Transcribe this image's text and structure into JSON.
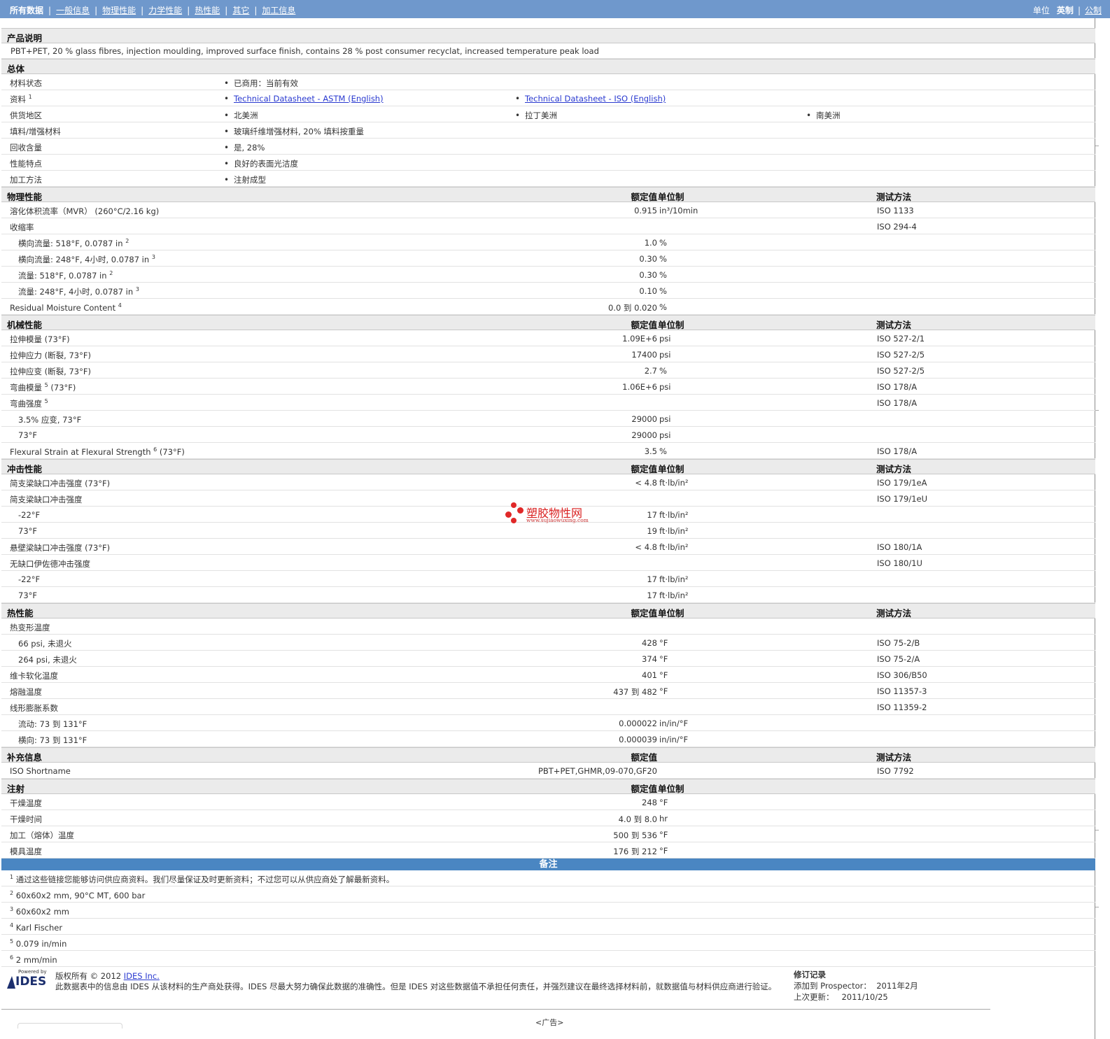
{
  "nav": {
    "items": [
      "所有数据",
      "一般信息",
      "物理性能",
      "力学性能",
      "热性能",
      "其它",
      "加工信息"
    ],
    "units_label": "单位",
    "unit_english": "英制",
    "unit_metric": "公制"
  },
  "product": {
    "heading": "产品说明",
    "description": "PBT+PET, 20 % glass fibres, injection moulding, improved surface finish, contains 28 % post consumer recyclat, increased temperature peak load"
  },
  "general": {
    "heading": "总体",
    "rows": [
      {
        "label": "材料状态",
        "sup": "",
        "values": [
          "已商用：当前有效"
        ]
      },
      {
        "label": "资料",
        "sup": "1",
        "values": [
          "Technical Datasheet - ASTM (English)",
          "Technical Datasheet - ISO (English)"
        ],
        "links": true
      },
      {
        "label": "供货地区",
        "sup": "",
        "values": [
          "北美洲",
          "拉丁美洲",
          "南美洲"
        ]
      },
      {
        "label": "填料/增强材料",
        "sup": "",
        "values": [
          "玻璃纤维增强材料, 20% 填料按重量"
        ]
      },
      {
        "label": "回收含量",
        "sup": "",
        "values": [
          "是, 28%"
        ]
      },
      {
        "label": "性能特点",
        "sup": "",
        "values": [
          "良好的表面光洁度"
        ]
      },
      {
        "label": "加工方法",
        "sup": "",
        "values": [
          "注射成型"
        ]
      }
    ]
  },
  "headers": {
    "nominal": "额定值",
    "unit": "单位制",
    "method": "测试方法"
  },
  "sections": [
    {
      "title": "物理性能",
      "show_unit": true,
      "show_method": true,
      "rows": [
        {
          "label": "溶化体积流率（MVR） (260°C/2.16 kg)",
          "sup": "",
          "value": "0.915",
          "unit": "in³/10min",
          "method": "ISO 1133",
          "sub": false
        },
        {
          "label": "收缩率",
          "sup": "",
          "value": "",
          "unit": "",
          "method": "ISO 294-4",
          "sub": false
        },
        {
          "label": "横向流量: 518°F, 0.0787 in",
          "sup": "2",
          "value": "1.0",
          "unit": "%",
          "method": "",
          "sub": true
        },
        {
          "label": "横向流量: 248°F, 4小时, 0.0787 in",
          "sup": "3",
          "value": "0.30",
          "unit": "%",
          "method": "",
          "sub": true
        },
        {
          "label": "流量: 518°F, 0.0787 in",
          "sup": "2",
          "value": "0.30",
          "unit": "%",
          "method": "",
          "sub": true
        },
        {
          "label": "流量: 248°F, 4小时, 0.0787 in",
          "sup": "3",
          "value": "0.10",
          "unit": "%",
          "method": "",
          "sub": true
        },
        {
          "label": "Residual Moisture Content",
          "sup": "4",
          "value": "0.0 到 0.020",
          "unit": "%",
          "method": "",
          "sub": false
        }
      ]
    },
    {
      "title": "机械性能",
      "show_unit": true,
      "show_method": true,
      "rows": [
        {
          "label": "拉伸模量 (73°F)",
          "sup": "",
          "value": "1.09E+6",
          "unit": "psi",
          "method": "ISO 527-2/1",
          "sub": false
        },
        {
          "label": "拉伸应力 (断裂, 73°F)",
          "sup": "",
          "value": "17400",
          "unit": "psi",
          "method": "ISO 527-2/5",
          "sub": false
        },
        {
          "label": "拉伸应变 (断裂, 73°F)",
          "sup": "",
          "value": "2.7",
          "unit": "%",
          "method": "ISO 527-2/5",
          "sub": false
        },
        {
          "label": "弯曲模量",
          "sup": "5",
          "suffix": " (73°F)",
          "value": "1.06E+6",
          "unit": "psi",
          "method": "ISO 178/A",
          "sub": false
        },
        {
          "label": "弯曲强度",
          "sup": "5",
          "value": "",
          "unit": "",
          "method": "ISO 178/A",
          "sub": false
        },
        {
          "label": "3.5% 应变, 73°F",
          "sup": "",
          "value": "29000",
          "unit": "psi",
          "method": "",
          "sub": true
        },
        {
          "label": "73°F",
          "sup": "",
          "value": "29000",
          "unit": "psi",
          "method": "",
          "sub": true
        },
        {
          "label": "Flexural Strain at Flexural Strength",
          "sup": "6",
          "suffix": " (73°F)",
          "value": "3.5",
          "unit": "%",
          "method": "ISO 178/A",
          "sub": false
        }
      ]
    },
    {
      "title": "冲击性能",
      "show_unit": true,
      "show_method": true,
      "rows": [
        {
          "label": "简支梁缺口冲击强度 (73°F)",
          "sup": "",
          "value": "< 4.8",
          "unit": "ft·lb/in²",
          "method": "ISO 179/1eA",
          "sub": false
        },
        {
          "label": "简支梁缺口冲击强度",
          "sup": "",
          "value": "",
          "unit": "",
          "method": "ISO 179/1eU",
          "sub": false
        },
        {
          "label": "-22°F",
          "sup": "",
          "value": "17",
          "unit": "ft·lb/in²",
          "method": "",
          "sub": true
        },
        {
          "label": "73°F",
          "sup": "",
          "value": "19",
          "unit": "ft·lb/in²",
          "method": "",
          "sub": true
        },
        {
          "label": "悬壁梁缺口冲击强度 (73°F)",
          "sup": "",
          "value": "< 4.8",
          "unit": "ft·lb/in²",
          "method": "ISO 180/1A",
          "sub": false
        },
        {
          "label": "无缺口伊佐德冲击强度",
          "sup": "",
          "value": "",
          "unit": "",
          "method": "ISO 180/1U",
          "sub": false
        },
        {
          "label": "-22°F",
          "sup": "",
          "value": "17",
          "unit": "ft·lb/in²",
          "method": "",
          "sub": true
        },
        {
          "label": "73°F",
          "sup": "",
          "value": "17",
          "unit": "ft·lb/in²",
          "method": "",
          "sub": true
        }
      ]
    },
    {
      "title": "热性能",
      "show_unit": true,
      "show_method": true,
      "rows": [
        {
          "label": "热变形温度",
          "sup": "",
          "value": "",
          "unit": "",
          "method": "",
          "sub": false
        },
        {
          "label": "66 psi, 未退火",
          "sup": "",
          "value": "428",
          "unit": "°F",
          "method": "ISO 75-2/B",
          "sub": true
        },
        {
          "label": "264 psi, 未退火",
          "sup": "",
          "value": "374",
          "unit": "°F",
          "method": "ISO 75-2/A",
          "sub": true
        },
        {
          "label": "维卡软化温度",
          "sup": "",
          "value": "401",
          "unit": "°F",
          "method": "ISO 306/B50",
          "sub": false
        },
        {
          "label": "熔融温度",
          "sup": "",
          "value": "437 到 482",
          "unit": "°F",
          "method": "ISO 11357-3",
          "sub": false
        },
        {
          "label": "线形膨胀系数",
          "sup": "",
          "value": "",
          "unit": "",
          "method": "ISO 11359-2",
          "sub": false
        },
        {
          "label": "流动: 73 到 131°F",
          "sup": "",
          "value": "0.000022",
          "unit": "in/in/°F",
          "method": "",
          "sub": true
        },
        {
          "label": "横向: 73 到 131°F",
          "sup": "",
          "value": "0.000039",
          "unit": "in/in/°F",
          "method": "",
          "sub": true
        }
      ]
    },
    {
      "title": "补充信息",
      "show_unit": false,
      "show_method": true,
      "rows": [
        {
          "label": "ISO Shortname",
          "sup": "",
          "value": "PBT+PET,GHMR,09-070,GF20",
          "unit": "",
          "method": "ISO 7792",
          "sub": false
        }
      ]
    },
    {
      "title": "注射",
      "show_unit": true,
      "show_method": false,
      "rows": [
        {
          "label": "干燥温度",
          "sup": "",
          "value": "248",
          "unit": "°F",
          "method": "",
          "sub": false
        },
        {
          "label": "干燥时间",
          "sup": "",
          "value": "4.0 到 8.0",
          "unit": "hr",
          "method": "",
          "sub": false
        },
        {
          "label": "加工（熔体）温度",
          "sup": "",
          "value": "500 到 536",
          "unit": "°F",
          "method": "",
          "sub": false
        },
        {
          "label": "模具温度",
          "sup": "",
          "value": "176 到 212",
          "unit": "°F",
          "method": "",
          "sub": false
        }
      ]
    }
  ],
  "notes": {
    "title": "备注",
    "items": [
      {
        "num": "1",
        "text": "通过这些链接您能够访问供应商资料。我们尽量保证及时更新资料；不过您可以从供应商处了解最新资料。"
      },
      {
        "num": "2",
        "text": "60x60x2 mm, 90°C MT, 600 bar"
      },
      {
        "num": "3",
        "text": "60x60x2 mm"
      },
      {
        "num": "4",
        "text": "Karl Fischer"
      },
      {
        "num": "5",
        "text": "0.079 in/min"
      },
      {
        "num": "6",
        "text": "2 mm/min"
      }
    ]
  },
  "footer": {
    "logo_powered": "Powered by",
    "logo_text": "IDES",
    "copyright_prefix": "版权所有 © 2012 ",
    "copyright_link": "IDES Inc.",
    "disclaimer": "此数据表中的信息由 IDES 从该材料的生产商处获得。IDES 尽最大努力确保此数据的准确性。但是 IDES 对这些数据值不承担任何责任，并强烈建议在最终选择材料前，就数据值与材料供应商进行验证。",
    "revision_title": "修订记录",
    "added_label": "添加到 Prospector：",
    "added_value": "2011年2月",
    "updated_label": "上次更新：",
    "updated_value": "2011/10/25",
    "ad_label": "<广告>"
  },
  "watermark": {
    "title": "塑胶物性网",
    "url": "www.sujiaowuxing.com"
  }
}
